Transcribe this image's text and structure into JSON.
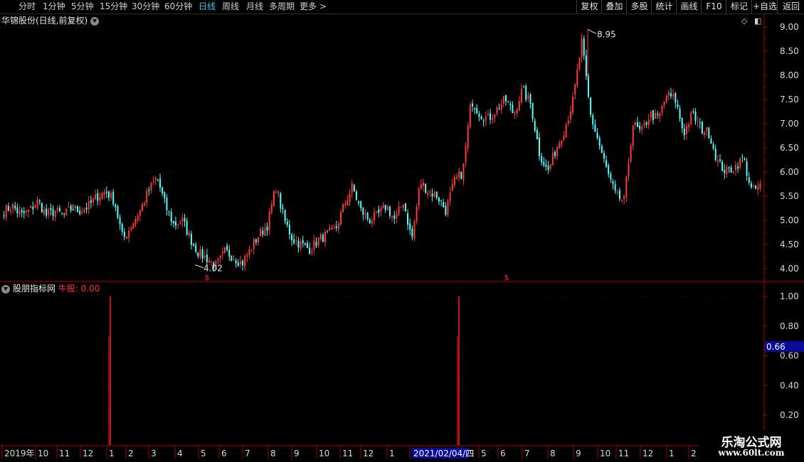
{
  "toolbar": {
    "timeframes": [
      {
        "label": "分时",
        "active": false
      },
      {
        "label": "1分钟",
        "active": false
      },
      {
        "label": "5分钟",
        "active": false
      },
      {
        "label": "15分钟",
        "active": false
      },
      {
        "label": "30分钟",
        "active": false
      },
      {
        "label": "60分钟",
        "active": false
      },
      {
        "label": "日线",
        "active": true
      },
      {
        "label": "周线",
        "active": false
      },
      {
        "label": "月线",
        "active": false
      },
      {
        "label": "多周期",
        "active": false
      },
      {
        "label": "更多 >",
        "active": false
      }
    ],
    "right_buttons": [
      "复权",
      "叠加",
      "多股",
      "统计",
      "画线",
      "F10",
      "标记",
      "+自选",
      "返回"
    ]
  },
  "stock": {
    "title": "华锦股份(日线,前复权)",
    "high_label": "8.95",
    "low_label": "4.02",
    "signal_marker": "$"
  },
  "price_axis": [
    "9.00",
    "8.50",
    "8.00",
    "7.50",
    "7.00",
    "6.50",
    "6.00",
    "5.50",
    "5.00",
    "4.50",
    "4.00"
  ],
  "indicator": {
    "name": "股朋指标网",
    "series_label": "牛股:",
    "series_value": "0.00",
    "axis": [
      "1.00",
      "0.80",
      "0.60",
      "0.40",
      "0.20"
    ],
    "current_value": "0.66"
  },
  "date_axis": [
    "2019年",
    "10",
    "11",
    "12",
    "1",
    "2",
    "3",
    "4",
    "5",
    "6",
    "7",
    "8",
    "9",
    "10",
    "11",
    "12",
    "1",
    "2",
    "3",
    "4",
    "5",
    "6",
    "7",
    "8",
    "9",
    "10",
    "11",
    "12",
    "1",
    "2"
  ],
  "cursor_date": "2021/02/04/四",
  "watermark": {
    "line1": "乐淘公式网",
    "line2": "www.60lt.com"
  },
  "colors": {
    "up": "#ff3a3a",
    "down": "#54ffff",
    "indicator": "#ff2020",
    "axis": "#b00000",
    "active": "#38c8e8",
    "highlight": "#0a0a9a"
  },
  "chart_data": {
    "type": "candlestick",
    "price_anchors": [
      5.2,
      5.3,
      5.1,
      5.2,
      5.4,
      5.1,
      5.2,
      5.1,
      5.25,
      5.2,
      5.3,
      5.5,
      5.6,
      5.4,
      4.6,
      4.9,
      5.2,
      5.6,
      5.9,
      5.3,
      4.9,
      5.0,
      4.6,
      4.3,
      4.2,
      4.05,
      4.35,
      4.25,
      4.1,
      4.4,
      4.7,
      4.9,
      5.7,
      5.0,
      4.6,
      4.5,
      4.4,
      4.6,
      4.7,
      4.8,
      5.3,
      5.7,
      5.2,
      5.0,
      5.1,
      5.3,
      5.0,
      5.4,
      4.6,
      5.8,
      5.6,
      5.5,
      5.2,
      5.8,
      6.0,
      7.5,
      7.2,
      7.1,
      7.3,
      7.5,
      7.2,
      7.7,
      7.4,
      6.4,
      6.0,
      6.5,
      6.9,
      7.5,
      8.7,
      7.2,
      6.6,
      6.0,
      5.5,
      5.4,
      7.0,
      6.8,
      7.2,
      7.1,
      7.6,
      7.5,
      6.8,
      7.2,
      6.9,
      6.8,
      6.2,
      6.0,
      6.1,
      6.3,
      5.6,
      5.7
    ],
    "high": 8.95,
    "low": 4.02,
    "indicator_spikes": [
      {
        "date_label": "1",
        "value": 1.0
      },
      {
        "date": "2021/02/04",
        "value": 1.0
      }
    ],
    "y_range_price": [
      4.0,
      9.0
    ],
    "y_range_indicator": [
      0.2,
      1.0
    ]
  }
}
